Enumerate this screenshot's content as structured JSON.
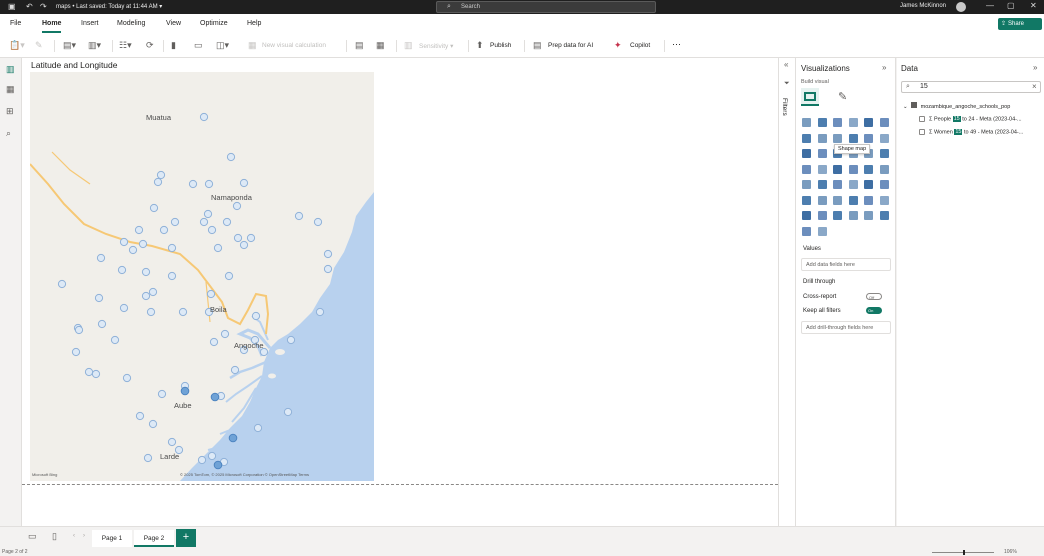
{
  "titlebar": {
    "doc_name": "maps",
    "save_status": "Last saved: Today at 11:44 AM",
    "search_placeholder": "Search",
    "user_name": "James McKinnon",
    "icons": [
      "save-icon",
      "undo-icon",
      "redo-icon",
      "minimize-icon",
      "restore-icon",
      "close-icon"
    ]
  },
  "ribbon_tabs": [
    "File",
    "Home",
    "Insert",
    "Modeling",
    "View",
    "Optimize",
    "Help"
  ],
  "active_tab": "Home",
  "share_label": "Share",
  "ribbon": {
    "new_visual_calc": "New visual calculation",
    "sensitivity": "Sensitivity",
    "publish": "Publish",
    "prep_data": "Prep data for AI",
    "copilot": "Copilot",
    "more": "⋯"
  },
  "canvas": {
    "visual_title": "Latitude and Longitude",
    "map_places": [
      "Muatua",
      "Namapanda",
      "Boila",
      "Angoche",
      "Aube",
      "Larde"
    ],
    "map_places_alt": {
      "Namapanda": "Namaponda"
    },
    "map_attribution": "© 2025 TomTom, © 2025 Microsoft Corporation  © OpenStreetMap  Terms",
    "map_logo": "Microsoft Bing"
  },
  "filters": {
    "label": "Filters"
  },
  "visualizations": {
    "title": "Visualizations",
    "build_visual": "Build visual",
    "tooltip": "Shape map",
    "values_label": "Values",
    "values_well": "Add data fields here",
    "drill_through": "Drill through",
    "cross_report": "Cross-report",
    "cross_report_state": "Off",
    "keep_all_filters": "Keep all filters",
    "keep_all_filters_state": "On",
    "drill_well": "Add drill-through fields here"
  },
  "data": {
    "title": "Data",
    "search_value": "15",
    "table_name": "mozambique_angoche_schools_pop",
    "fields": [
      {
        "pre": "People ",
        "hl": "15",
        "post": " to 24 - Meta (2023-04-..."
      },
      {
        "pre": "Women ",
        "hl": "15",
        "post": " to 49 - Meta (2023-04-..."
      }
    ]
  },
  "pages": {
    "tabs": [
      "Page 1",
      "Page 2"
    ],
    "active": "Page 2",
    "add": "+"
  },
  "status": {
    "page_indicator": "Page 2 of 2",
    "zoom": "106%"
  }
}
